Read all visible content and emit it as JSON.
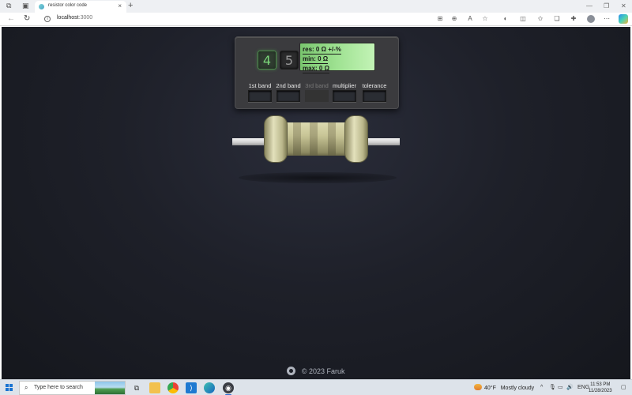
{
  "browser": {
    "tab_title": "resistor color code",
    "tab_close": "×",
    "new_tab": "+",
    "window_minimize": "—",
    "window_restore": "❐",
    "window_close": "✕",
    "url_host": "localhost",
    "url_port": ":3000"
  },
  "app": {
    "band_count_options": [
      "4",
      "5"
    ],
    "selected_band_count": "4",
    "display": {
      "resistance": "res: 0 Ω +/-%",
      "min": "min: 0 Ω",
      "max": "max: 0 Ω"
    },
    "bands": [
      {
        "label": "1st band",
        "enabled": true
      },
      {
        "label": "2nd band",
        "enabled": true
      },
      {
        "label": "3rd band",
        "enabled": false
      },
      {
        "label": "multiplier",
        "enabled": true
      },
      {
        "label": "tolerance",
        "enabled": true
      }
    ],
    "footer": "© 2023 Faruk",
    "colors": {
      "page_bg": "#1e2029",
      "lcd_green": "#9fe292",
      "active_digit": "#7ad678",
      "resistor_body": "#c8c596"
    }
  },
  "taskbar": {
    "search_placeholder": "Type here to search",
    "weather_temp": "40°F",
    "weather_desc": "Mostly cloudy",
    "language": "ENG",
    "time": "11:53 PM",
    "date": "11/28/2023",
    "apps": [
      "task-view",
      "file-explorer",
      "chrome",
      "vscode",
      "edge",
      "app"
    ]
  }
}
